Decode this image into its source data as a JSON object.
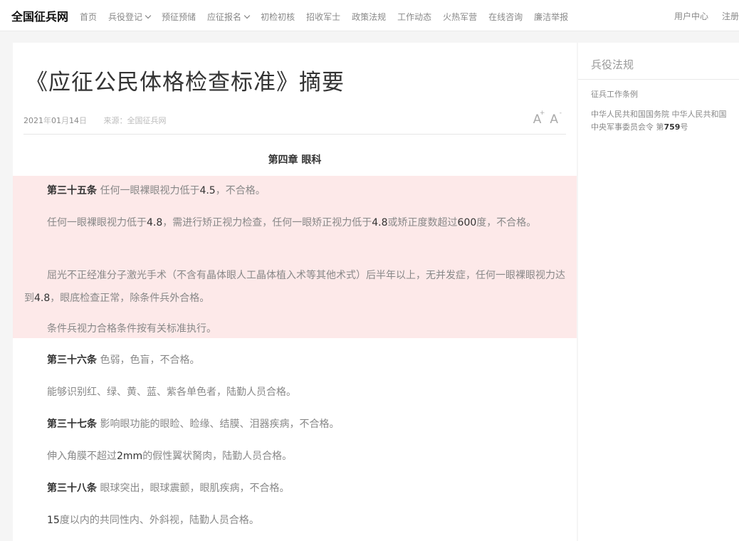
{
  "nav": {
    "logo": "全国征兵网",
    "items": [
      {
        "label": "首页"
      },
      {
        "label": "兵役登记",
        "dropdown": true
      },
      {
        "label": "预征预储"
      },
      {
        "label": "应征报名",
        "dropdown": true
      },
      {
        "label": "初检初核"
      },
      {
        "label": "招收军士"
      },
      {
        "label": "政策法规"
      },
      {
        "label": "工作动态"
      },
      {
        "label": "火热军营"
      },
      {
        "label": "在线咨询"
      },
      {
        "label": "廉洁举报"
      }
    ],
    "user_center": "用户中心",
    "register": "注册"
  },
  "article": {
    "title": "《应征公民体格检查标准》摘要",
    "date": {
      "year": "2021",
      "year_unit": "年",
      "month": "01",
      "month_unit": "月",
      "day": "14",
      "day_unit": "日"
    },
    "source": "来源：全国征兵网",
    "font_increase": "A",
    "font_increase_sign": "+",
    "font_decrease": "A",
    "font_decrease_sign": "-",
    "chapter": "第四章 眼科",
    "p1": {
      "article": "第三十五条",
      "a": " 任何一眼裸眼视力低于",
      "v1": "4.5",
      "b": "，不合格。"
    },
    "p2": {
      "a": "任何一眼裸眼视力低于",
      "v1": "4.8",
      "b": "，需进行矫正视力检查，任何一眼矫正视力低于",
      "v2": "4.8",
      "c": "或矫正度数超过",
      "v3": "600",
      "d": "度，不合格。"
    },
    "p3": {
      "a": "屈光不正经准分子激光手术（不含有晶体眼人工晶体植入术等其他术式）后半年以上，无并发症，任何一眼裸眼视力达到",
      "v1": "4.8",
      "b": "，眼底检查正常，除条件兵外合格。"
    },
    "p4": "条件兵视力合格条件按有关标准执行。",
    "p5": {
      "article": "第三十六条",
      "a": " 色弱，色盲，不合格。"
    },
    "p6": "能够识别红、绿、黄、蓝、紫各单色者，陆勤人员合格。",
    "p7": {
      "article": "第三十七条",
      "a": " 影响眼功能的眼睑、睑缘、结膜、泪器疾病，不合格。"
    },
    "p8": {
      "a": "伸入角膜不超过",
      "v1": "2mm",
      "b": "的假性翼状胬肉，陆勤人员合格。"
    },
    "p9": {
      "article": "第三十八条",
      "a": " 眼球突出，眼球震颤，眼肌疾病，不合格。"
    },
    "p10": {
      "v1": "15",
      "a": "度以内的共同性内、外斜视，陆勤人员合格。"
    }
  },
  "sidebar": {
    "title": "兵役法规",
    "link1": "征兵工作条例",
    "link2_a": "中华人民共和国国务院 中华人民共和国中央军事委员会令 第",
    "link2_num": "759",
    "link2_b": "号"
  },
  "colors": {
    "highlight": "#fde9e9",
    "text_dark": "#333333",
    "text_muted": "#888888"
  }
}
